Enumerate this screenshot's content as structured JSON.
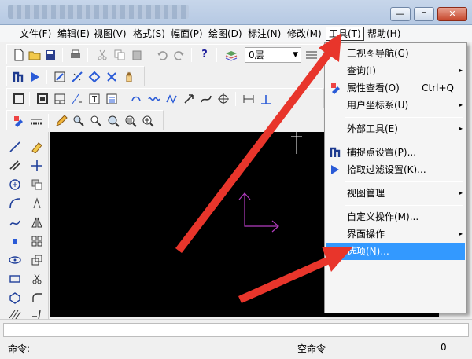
{
  "window": {
    "minimize_glyph": "—",
    "maximize_glyph": "▫",
    "close_glyph": "✕"
  },
  "menubar": {
    "items": [
      {
        "label": "文件(F)"
      },
      {
        "label": "编辑(E)"
      },
      {
        "label": "视图(V)"
      },
      {
        "label": "格式(S)"
      },
      {
        "label": "幅面(P)"
      },
      {
        "label": "绘图(D)"
      },
      {
        "label": "标注(N)"
      },
      {
        "label": "修改(M)"
      },
      {
        "label": "工具(T)",
        "active": true
      },
      {
        "label": "帮助(H)"
      }
    ]
  },
  "toolbar": {
    "layer_value": "0层",
    "help_glyph": "?"
  },
  "tools_menu": {
    "items": [
      {
        "label": "三视图导航(G)"
      },
      {
        "label": "查询(I)",
        "submenu": true
      },
      {
        "label": "属性查看(O)",
        "shortcut": "Ctrl+Q"
      },
      {
        "label": "用户坐标系(U)",
        "submenu": true
      },
      {
        "label": "外部工具(E)",
        "submenu": true
      },
      {
        "label": "捕捉点设置(P)..."
      },
      {
        "label": "拾取过滤设置(K)..."
      },
      {
        "label": "视图管理",
        "submenu": true
      },
      {
        "label": "自定义操作(M)..."
      },
      {
        "label": "界面操作",
        "submenu": true
      },
      {
        "label": "选项(N)...",
        "highlighted": true
      }
    ],
    "submenu_glyph": "▸"
  },
  "statusbar": {
    "command_label": "命令:",
    "state_text": "空命令",
    "right_fragment": "0"
  },
  "colors": {
    "highlight": "#3399ff",
    "arrow_red": "#e8352b",
    "canvas": "#000000",
    "axis_magenta": "#b23dbf"
  }
}
